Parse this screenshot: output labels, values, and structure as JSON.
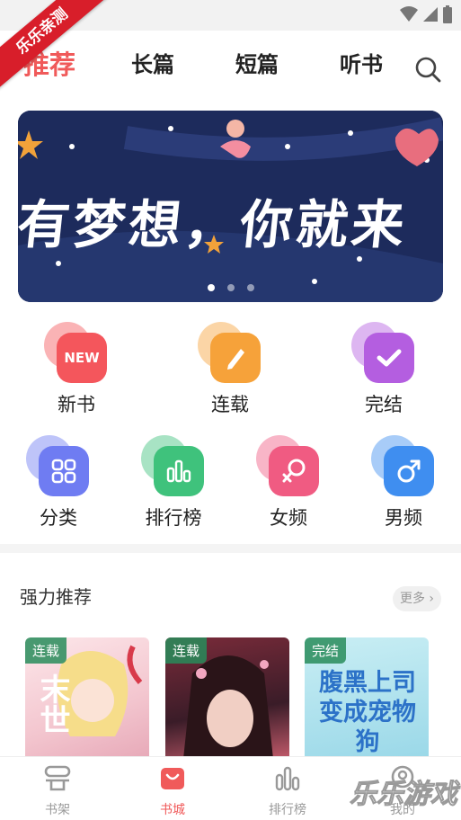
{
  "watermark": {
    "ribbon": "乐乐亲测",
    "site": "乐乐游戏"
  },
  "top_tabs": [
    {
      "label": "推荐",
      "active": true
    },
    {
      "label": "长篇",
      "active": false
    },
    {
      "label": "短篇",
      "active": false
    },
    {
      "label": "听书",
      "active": false
    }
  ],
  "banner": {
    "text": "有梦想，你就来",
    "slides": 3,
    "active_slide": 1
  },
  "categories_row1": [
    {
      "label": "新书",
      "icon": "new-icon",
      "color": "#f4565c"
    },
    {
      "label": "连载",
      "icon": "pencil-icon",
      "color": "#f6a23a"
    },
    {
      "label": "完结",
      "icon": "check-icon",
      "color": "#b45ee0"
    }
  ],
  "categories_row2": [
    {
      "label": "分类",
      "icon": "grid-icon",
      "color": "#6f7cf2"
    },
    {
      "label": "排行榜",
      "icon": "bar-chart-icon",
      "color": "#3fc27c"
    },
    {
      "label": "女频",
      "icon": "female-icon",
      "color": "#f05b82"
    },
    {
      "label": "男频",
      "icon": "male-icon",
      "color": "#3f8ef0"
    }
  ],
  "section": {
    "title": "强力推荐",
    "more_label": "更多"
  },
  "books": [
    {
      "badge": "连载",
      "cover_text": "末世"
    },
    {
      "badge": "连载",
      "cover_text": ""
    },
    {
      "badge": "完结",
      "cover_text": "腹黑上司变成宠物狗"
    }
  ],
  "bottom_nav": [
    {
      "label": "书架",
      "active": false
    },
    {
      "label": "书城",
      "active": true
    },
    {
      "label": "排行榜",
      "active": false
    },
    {
      "label": "我的",
      "active": false
    }
  ],
  "colors": {
    "accent": "#f05a5a",
    "banner_bg": "#1d2b5c"
  }
}
